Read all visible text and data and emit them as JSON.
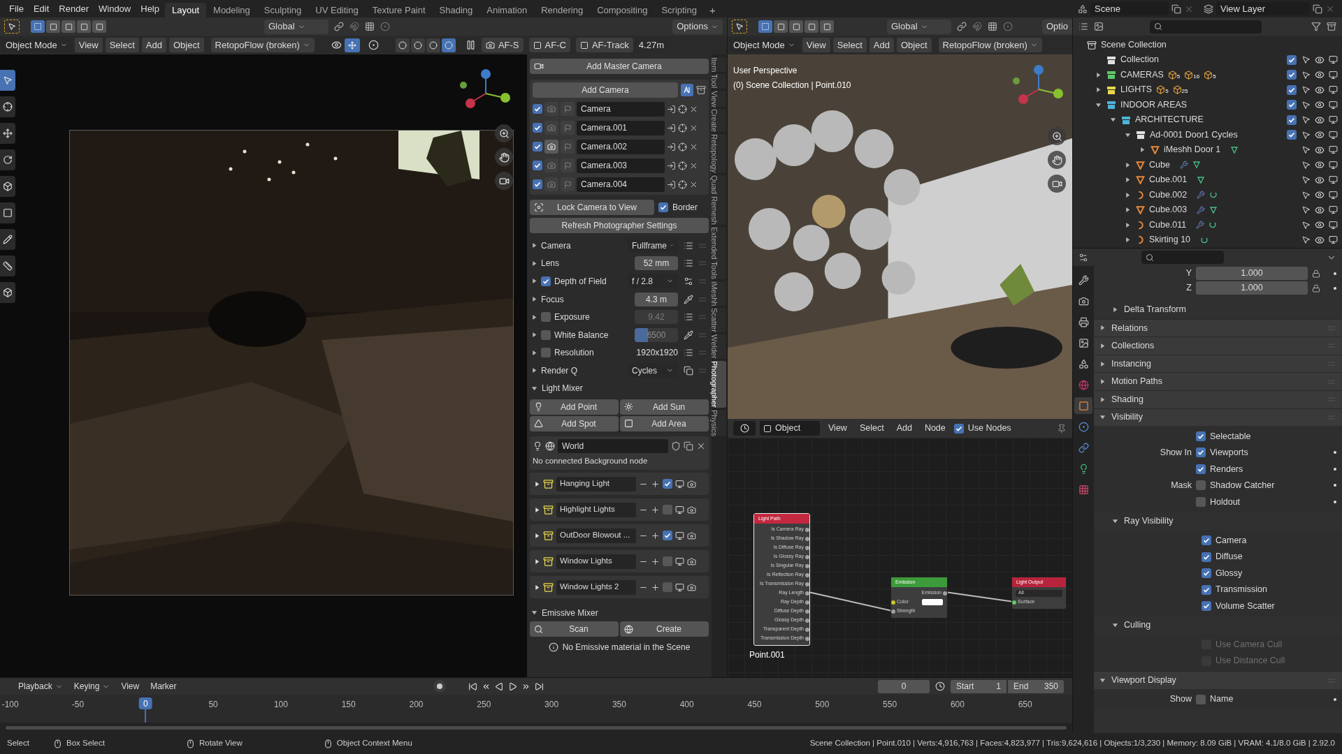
{
  "top_bar": {
    "menus": [
      "File",
      "Edit",
      "Render",
      "Window",
      "Help"
    ],
    "workspaces": [
      {
        "label": "Layout",
        "selected": true
      },
      {
        "label": "Modeling",
        "selected": false
      },
      {
        "label": "Sculpting",
        "selected": false
      },
      {
        "label": "UV Editing",
        "selected": false
      },
      {
        "label": "Texture Paint",
        "selected": false
      },
      {
        "label": "Shading",
        "selected": false
      },
      {
        "label": "Animation",
        "selected": false
      },
      {
        "label": "Rendering",
        "selected": false
      },
      {
        "label": "Compositing",
        "selected": false
      },
      {
        "label": "Scripting",
        "selected": false
      }
    ],
    "add_workspace": "+",
    "scene": "Scene",
    "view_layer": "View Layer"
  },
  "camera_view": {
    "tool_header": {
      "orientation": "Global",
      "options": "Options"
    },
    "header": {
      "mode": "Object Mode",
      "menus": [
        "View",
        "Select",
        "Add",
        "Object"
      ],
      "addon": "RetopoFlow (broken)",
      "af_buttons": [
        "AF-S",
        "AF-C",
        "AF-Track"
      ],
      "focus_distance": "4.27m"
    }
  },
  "photographer": {
    "add_master_camera": "Add Master Camera",
    "add_camera": "Add Camera",
    "cameras": [
      {
        "name": "Camera",
        "enabled": true,
        "active": false
      },
      {
        "name": "Camera.001",
        "enabled": true,
        "active": false
      },
      {
        "name": "Camera.002",
        "enabled": true,
        "active": true
      },
      {
        "name": "Camera.003",
        "enabled": true,
        "active": false
      },
      {
        "name": "Camera.004",
        "enabled": true,
        "active": false
      }
    ],
    "lock_camera": "Lock Camera to View",
    "border": {
      "label": "Border",
      "checked": true
    },
    "refresh": "Refresh Photographer Settings",
    "settings": [
      {
        "label": "Camera",
        "kind": "dropdown",
        "value": "Fullframe",
        "expanded": false
      },
      {
        "label": "Lens",
        "kind": "field",
        "value": "52 mm",
        "expanded": false
      },
      {
        "label": "Depth of Field",
        "kind": "dropdown",
        "value": "f / 2.8",
        "checked": true,
        "expanded": false
      },
      {
        "label": "Focus",
        "kind": "field",
        "value": "4.3 m",
        "expanded": false
      },
      {
        "label": "Exposure",
        "kind": "field",
        "value": "9.42",
        "checked": false,
        "expanded": false
      },
      {
        "label": "White Balance",
        "kind": "slider",
        "value": "6500",
        "checked": false,
        "level": 0.3,
        "expanded": false
      },
      {
        "label": "Resolution",
        "kind": "text",
        "value": "1920x1920",
        "checked": false,
        "expanded": false
      },
      {
        "label": "Render Q",
        "kind": "dropdown",
        "value": "Cycles",
        "expanded": false
      }
    ],
    "light_mixer": {
      "title": "Light Mixer",
      "expanded": true,
      "buttons": [
        "Add Point",
        "Add Sun",
        "Add Spot",
        "Add Area"
      ],
      "world": "World",
      "world_note": "No connected Background node",
      "lights": [
        {
          "name": "Hanging Light",
          "enabled": true
        },
        {
          "name": "Highlight Lights",
          "enabled": false
        },
        {
          "name": "OutDoor Blowout ...",
          "enabled": true
        },
        {
          "name": "Window Lights",
          "enabled": false
        },
        {
          "name": "Window Lights 2",
          "enabled": false
        }
      ]
    },
    "emissive_mixer": {
      "title": "Emissive Mixer",
      "expanded": true,
      "buttons": [
        "Scan",
        "Create"
      ],
      "note": "No Emissive material in the Scene"
    },
    "tabs": [
      {
        "label": "Item",
        "selected": false
      },
      {
        "label": "Tool",
        "selected": false
      },
      {
        "label": "View",
        "selected": false
      },
      {
        "label": "Create",
        "selected": false
      },
      {
        "label": "Retopology",
        "selected": false
      },
      {
        "label": "Quad Remesh",
        "selected": false
      },
      {
        "label": "Extended Tools",
        "selected": false
      },
      {
        "label": "iMeshh",
        "selected": false
      },
      {
        "label": "Scatter",
        "selected": false
      },
      {
        "label": "Welder",
        "selected": false
      },
      {
        "label": "Photographer",
        "selected": true
      },
      {
        "label": "Physics",
        "selected": false
      }
    ]
  },
  "scene_view": {
    "tool_header": {
      "orientation": "Global",
      "options": "Optio"
    },
    "header": {
      "mode": "Object Mode",
      "menus": [
        "View",
        "Select",
        "Add",
        "Object"
      ],
      "addon": "RetopoFlow (broken)"
    },
    "overlay": [
      "User Perspective",
      "(0) Scene Collection | Point.010"
    ]
  },
  "node_editor": {
    "header": {
      "object": "Object",
      "menus": [
        "View",
        "Select",
        "Add",
        "Node"
      ],
      "use_nodes": {
        "label": "Use Nodes",
        "checked": true
      }
    },
    "nodes": [
      {
        "title": "Light Path",
        "color": "#c3283f",
        "selected": true,
        "outputs": [
          "Is Camera Ray",
          "Is Shadow Ray",
          "Is Diffuse Ray",
          "Is Glossy Ray",
          "Is Singular Ray",
          "Is Reflection Ray",
          "Is Transmission Ray",
          "Ray Length",
          "Ray Depth",
          "Diffuse Depth",
          "Glossy Depth",
          "Transparent Depth",
          "Transmission Depth"
        ]
      },
      {
        "title": "Emission",
        "color": "#3c9b3a",
        "selected": false,
        "outputs": [
          "Emission"
        ],
        "inputs": [
          "Color",
          "Strength"
        ]
      },
      {
        "title": "Light Output",
        "color": "#b8243c",
        "selected": false,
        "target": "All",
        "inputs": [
          "Surface"
        ]
      }
    ],
    "object_name": "Point.001"
  },
  "outliner": {
    "root": "Scene Collection",
    "items": [
      {
        "name": "Collection",
        "kind": "collection",
        "color": "#e0e0e0",
        "checked": true
      },
      {
        "name": "CAMERAS",
        "kind": "collection",
        "color": "#5ec76a",
        "checked": true,
        "expanded": false,
        "badges": [
          "5",
          "16",
          "5"
        ]
      },
      {
        "name": "LIGHTS",
        "kind": "collection",
        "color": "#e8d84a",
        "checked": true,
        "expanded": false,
        "badges": [
          "5",
          "25"
        ]
      },
      {
        "name": "INDOOR AREAS",
        "kind": "collection",
        "color": "#4fb3d9",
        "checked": true,
        "expanded": true,
        "children": [
          {
            "name": "ARCHITECTURE",
            "kind": "collection",
            "color": "#4fb3d9",
            "checked": true,
            "expanded": true,
            "children": [
              {
                "name": "Ad-0001 Door1 Cycles",
                "kind": "collection",
                "color": "#e0e0e0",
                "checked": true,
                "expanded": true,
                "children": [
                  {
                    "name": "iMeshh Door 1",
                    "kind": "mesh",
                    "expanded": false,
                    "modifier": false
                  }
                ]
              },
              {
                "name": "Cube",
                "kind": "mesh",
                "expanded": false,
                "modifier": true
              },
              {
                "name": "Cube.001",
                "kind": "mesh",
                "expanded": false,
                "modifier": false
              },
              {
                "name": "Cube.002",
                "kind": "curve",
                "expanded": false,
                "modifier": true
              },
              {
                "name": "Cube.003",
                "kind": "mesh",
                "expanded": false,
                "modifier": true
              },
              {
                "name": "Cube.011",
                "kind": "curve",
                "expanded": false,
                "modifier": true
              },
              {
                "name": "Skirting 10",
                "kind": "curve",
                "expanded": false,
                "modifier": false
              }
            ]
          }
        ]
      }
    ]
  },
  "properties": {
    "tabs": [
      {
        "kind": "tool",
        "selected": false
      },
      {
        "kind": "render",
        "selected": false
      },
      {
        "kind": "output",
        "selected": false
      },
      {
        "kind": "view_layer",
        "selected": false
      },
      {
        "kind": "scene",
        "selected": false
      },
      {
        "kind": "world",
        "selected": false
      },
      {
        "kind": "object",
        "selected": true
      },
      {
        "kind": "physics",
        "selected": false
      },
      {
        "kind": "constraints",
        "selected": false
      },
      {
        "kind": "data",
        "selected": false
      },
      {
        "kind": "texture",
        "selected": false
      }
    ],
    "fields": [
      {
        "label": "Y",
        "value": "1.000"
      },
      {
        "label": "Z",
        "value": "1.000"
      }
    ],
    "panels": [
      {
        "title": "Delta Transform",
        "sub": true,
        "expanded": false
      },
      {
        "title": "Relations",
        "sub": false,
        "expanded": false
      },
      {
        "title": "Collections",
        "sub": false,
        "expanded": false
      },
      {
        "title": "Instancing",
        "sub": false,
        "expanded": false
      },
      {
        "title": "Motion Paths",
        "sub": false,
        "expanded": false
      },
      {
        "title": "Shading",
        "sub": false,
        "expanded": false
      },
      {
        "title": "Visibility",
        "sub": false,
        "expanded": true,
        "rows": [
          {
            "label": "Selectable",
            "checked": true,
            "keyframe_dot": false
          },
          {
            "group": "Show In",
            "label": "Viewports",
            "checked": true,
            "keyframe_dot": true
          },
          {
            "label": "Renders",
            "checked": true,
            "keyframe_dot": true
          },
          {
            "group": "Mask",
            "label": "Shadow Catcher",
            "checked": false,
            "keyframe_dot": true
          },
          {
            "label": "Holdout",
            "checked": false,
            "keyframe_dot": true
          }
        ]
      },
      {
        "title": "Ray Visibility",
        "sub": true,
        "expanded": true,
        "rows": [
          {
            "label": "Camera",
            "checked": true
          },
          {
            "label": "Diffuse",
            "checked": true
          },
          {
            "label": "Glossy",
            "checked": true
          },
          {
            "label": "Transmission",
            "checked": true
          },
          {
            "label": "Volume Scatter",
            "checked": true
          }
        ]
      },
      {
        "title": "Culling",
        "sub": true,
        "expanded": true,
        "rows": [
          {
            "label": "Use Camera Cull",
            "checked": false,
            "disabled": true
          },
          {
            "label": "Use Distance Cull",
            "checked": false,
            "disabled": true
          }
        ]
      },
      {
        "title": "Viewport Display",
        "sub": false,
        "expanded": true,
        "rows": [
          {
            "group": "Show",
            "label": "Name",
            "checked": false,
            "keyframe_dot": true
          }
        ]
      }
    ]
  },
  "timeline": {
    "menus": [
      "Playback",
      "Keying",
      "View",
      "Marker"
    ],
    "current_frame": "0",
    "start": {
      "label": "Start",
      "value": "1"
    },
    "end": {
      "label": "End",
      "value": "350"
    },
    "frames": [
      {
        "label": "-100",
        "selected": false
      },
      {
        "label": "-50",
        "selected": false
      },
      {
        "label": "0",
        "selected": true
      },
      {
        "label": "50",
        "selected": false
      },
      {
        "label": "100",
        "selected": false
      },
      {
        "label": "150",
        "selected": false
      },
      {
        "label": "200",
        "selected": false
      },
      {
        "label": "250",
        "selected": false
      },
      {
        "label": "300",
        "selected": false
      },
      {
        "label": "350",
        "selected": false
      },
      {
        "label": "400",
        "selected": false
      },
      {
        "label": "450",
        "selected": false
      },
      {
        "label": "500",
        "selected": false
      },
      {
        "label": "550",
        "selected": false
      },
      {
        "label": "600",
        "selected": false
      },
      {
        "label": "650",
        "selected": false
      }
    ]
  },
  "status_bar": {
    "hints": [
      "Select",
      "Box Select",
      "Rotate View",
      "Object Context Menu"
    ],
    "stats": "Scene Collection | Point.010 | Verts:4,916,763 | Faces:4,823,977 | Tris:9,624,616 | Objects:1/3,230 | Memory: 8.09 GiB | VRAM: 4.1/8.0 GiB | 2.92.0"
  }
}
